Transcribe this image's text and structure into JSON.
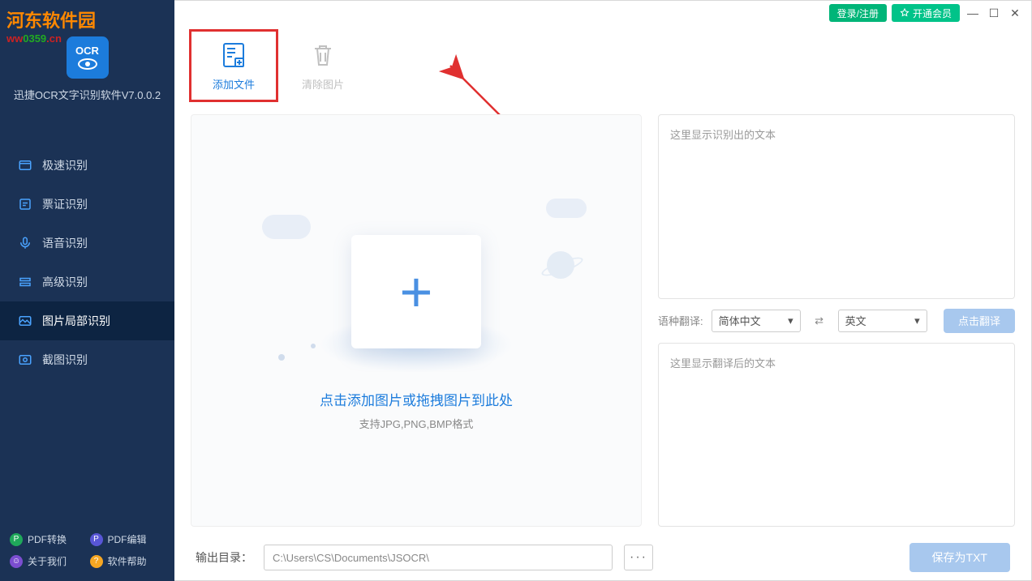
{
  "watermark": {
    "text1": "河东软件园",
    "url_prefix": "ww",
    "url_mid": "0359",
    "url_suffix": ".cn"
  },
  "app": {
    "logo_text": "OCR",
    "title": "迅捷OCR文字识别软件V7.0.0.2"
  },
  "titlebar": {
    "login": "登录/注册",
    "vip": "开通会员"
  },
  "nav": {
    "items": [
      {
        "label": "极速识别"
      },
      {
        "label": "票证识别"
      },
      {
        "label": "语音识别"
      },
      {
        "label": "高级识别"
      },
      {
        "label": "图片局部识别"
      },
      {
        "label": "截图识别"
      }
    ]
  },
  "bottom": {
    "pdf_convert": "PDF转换",
    "pdf_edit": "PDF编辑",
    "about": "关于我们",
    "help": "软件帮助"
  },
  "toolbar": {
    "add_files": "添加文件",
    "clear_images": "清除图片"
  },
  "drop": {
    "title": "点击添加图片或拖拽图片到此处",
    "subtitle": "支持JPG,PNG,BMP格式"
  },
  "right": {
    "recognized_placeholder": "这里显示识别出的文本",
    "translate_label": "语种翻译:",
    "lang_from": "简体中文",
    "lang_to": "英文",
    "translate_btn": "点击翻译",
    "translated_placeholder": "这里显示翻译后的文本"
  },
  "footer": {
    "out_label": "输出目录：",
    "out_path": "C:\\Users\\CS\\Documents\\JSOCR\\",
    "save_btn": "保存为TXT"
  }
}
